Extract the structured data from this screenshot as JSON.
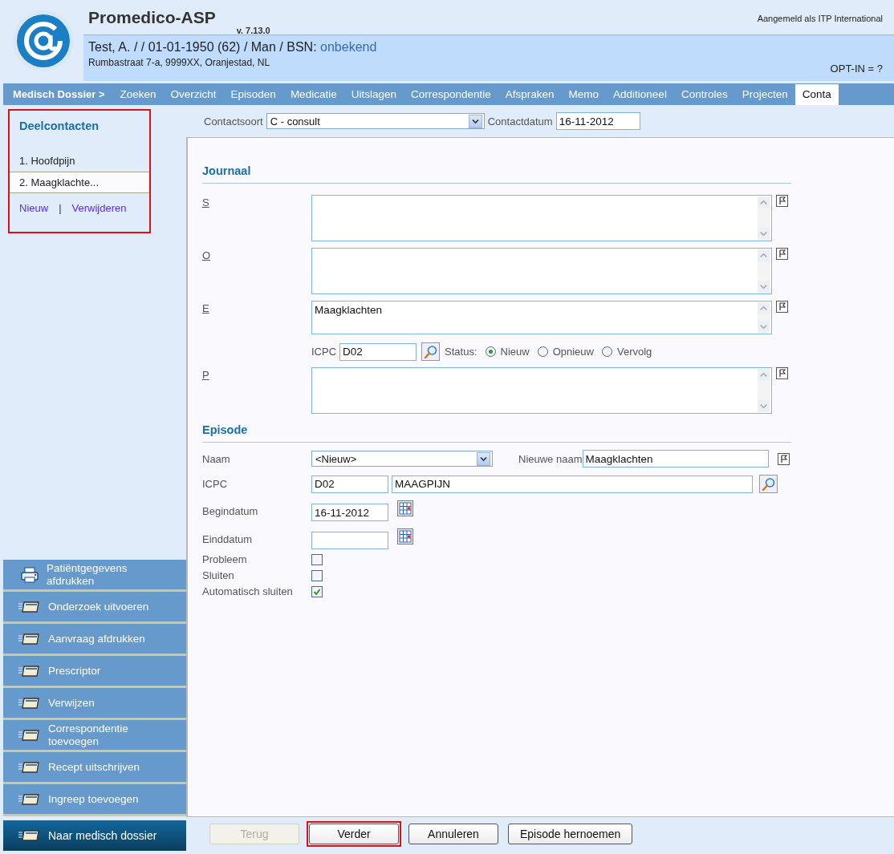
{
  "header": {
    "app_title": "Promedico-ASP",
    "version": "v. 7.13.0",
    "logged_in": "Aangemeld als ITP International",
    "patient": {
      "summary": "Test, A. / / 01-01-1950 (62) / Man / BSN:",
      "bsn": "onbekend",
      "address": "Rumbastraat 7-a, 9999XX, Oranjestad, NL",
      "opt_in": "OPT-IN = ?"
    }
  },
  "nav": {
    "section": "Medisch Dossier >",
    "tabs": [
      {
        "label": "Zoeken",
        "selected": false
      },
      {
        "label": "Overzicht",
        "selected": false
      },
      {
        "label": "Episoden",
        "selected": false
      },
      {
        "label": "Medicatie",
        "selected": false
      },
      {
        "label": "Uitslagen",
        "selected": false
      },
      {
        "label": "Correspondentie",
        "selected": false
      },
      {
        "label": "Afspraken",
        "selected": false
      },
      {
        "label": "Memo",
        "selected": false
      },
      {
        "label": "Additioneel",
        "selected": false
      },
      {
        "label": "Controles",
        "selected": false
      },
      {
        "label": "Projecten",
        "selected": false
      },
      {
        "label": "Conta",
        "selected": true
      }
    ]
  },
  "sidebar": {
    "subcontacts": {
      "title": "Deelcontacten",
      "highlighted": true,
      "items": [
        {
          "label": "1. Hoofdpijn",
          "selected": false
        },
        {
          "label": "2. Maagklachte...",
          "selected": true
        }
      ],
      "links": [
        "Nieuw",
        "Verwijderen"
      ],
      "separator": "|"
    },
    "actions": [
      {
        "label": "Patiëntgegevens afdrukken",
        "kind": "print"
      },
      {
        "label": "Onderzoek uitvoeren",
        "kind": "folder"
      },
      {
        "label": "Aanvraag afdrukken",
        "kind": "folder"
      },
      {
        "label": "Prescriptor",
        "kind": "folder"
      },
      {
        "label": "Verwijzen",
        "kind": "folder"
      },
      {
        "label": "Correspondentie toevoegen",
        "kind": "folder"
      },
      {
        "label": "Recept uitschrijven",
        "kind": "folder"
      },
      {
        "label": "Ingreep toevoegen",
        "kind": "folder"
      }
    ],
    "footer_action": "Naar medisch dossier"
  },
  "contact": {
    "type_label": "Contactsoort",
    "type_value": "C - consult",
    "date_label": "Contactdatum",
    "date_value": "16-11-2012"
  },
  "journal": {
    "title": "Journaal",
    "entries": [
      {
        "label": "S"
      },
      {
        "label": "O"
      },
      {
        "label": "E",
        "value": "Maagklachten"
      },
      {
        "label": "P"
      }
    ],
    "icpc": {
      "label": "ICPC",
      "value": "D02",
      "status_label": "Status:",
      "options": [
        {
          "label": "Nieuw",
          "selected": true
        },
        {
          "label": "Opnieuw",
          "selected": false
        },
        {
          "label": "Vervolg",
          "selected": false
        }
      ]
    }
  },
  "episode": {
    "title": "Episode",
    "rows": [
      {
        "kind": "select",
        "label": "Naam",
        "value": "<Nieuw>",
        "extra_label": "Nieuwe naam",
        "extra_value": "Maagklachten"
      },
      {
        "kind": "icpc",
        "label": "ICPC",
        "code": "D02",
        "description": "MAAGPIJN"
      },
      {
        "kind": "date",
        "label": "Begindatum",
        "value": "16-11-2012"
      },
      {
        "kind": "date",
        "label": "Einddatum"
      },
      {
        "kind": "checkbox",
        "label": "Probleem",
        "checked": false
      },
      {
        "kind": "checkbox",
        "label": "Sluiten",
        "checked": false
      },
      {
        "kind": "checkbox",
        "label": "Automatisch sluiten",
        "checked": true
      }
    ]
  },
  "buttons": [
    {
      "label": "Terug",
      "disabled": true,
      "highlighted": false
    },
    {
      "label": "Verder",
      "disabled": false,
      "highlighted": true
    },
    {
      "label": "Annuleren",
      "disabled": false,
      "highlighted": false
    },
    {
      "label": "Episode hernoemen",
      "disabled": false,
      "highlighted": false
    }
  ]
}
